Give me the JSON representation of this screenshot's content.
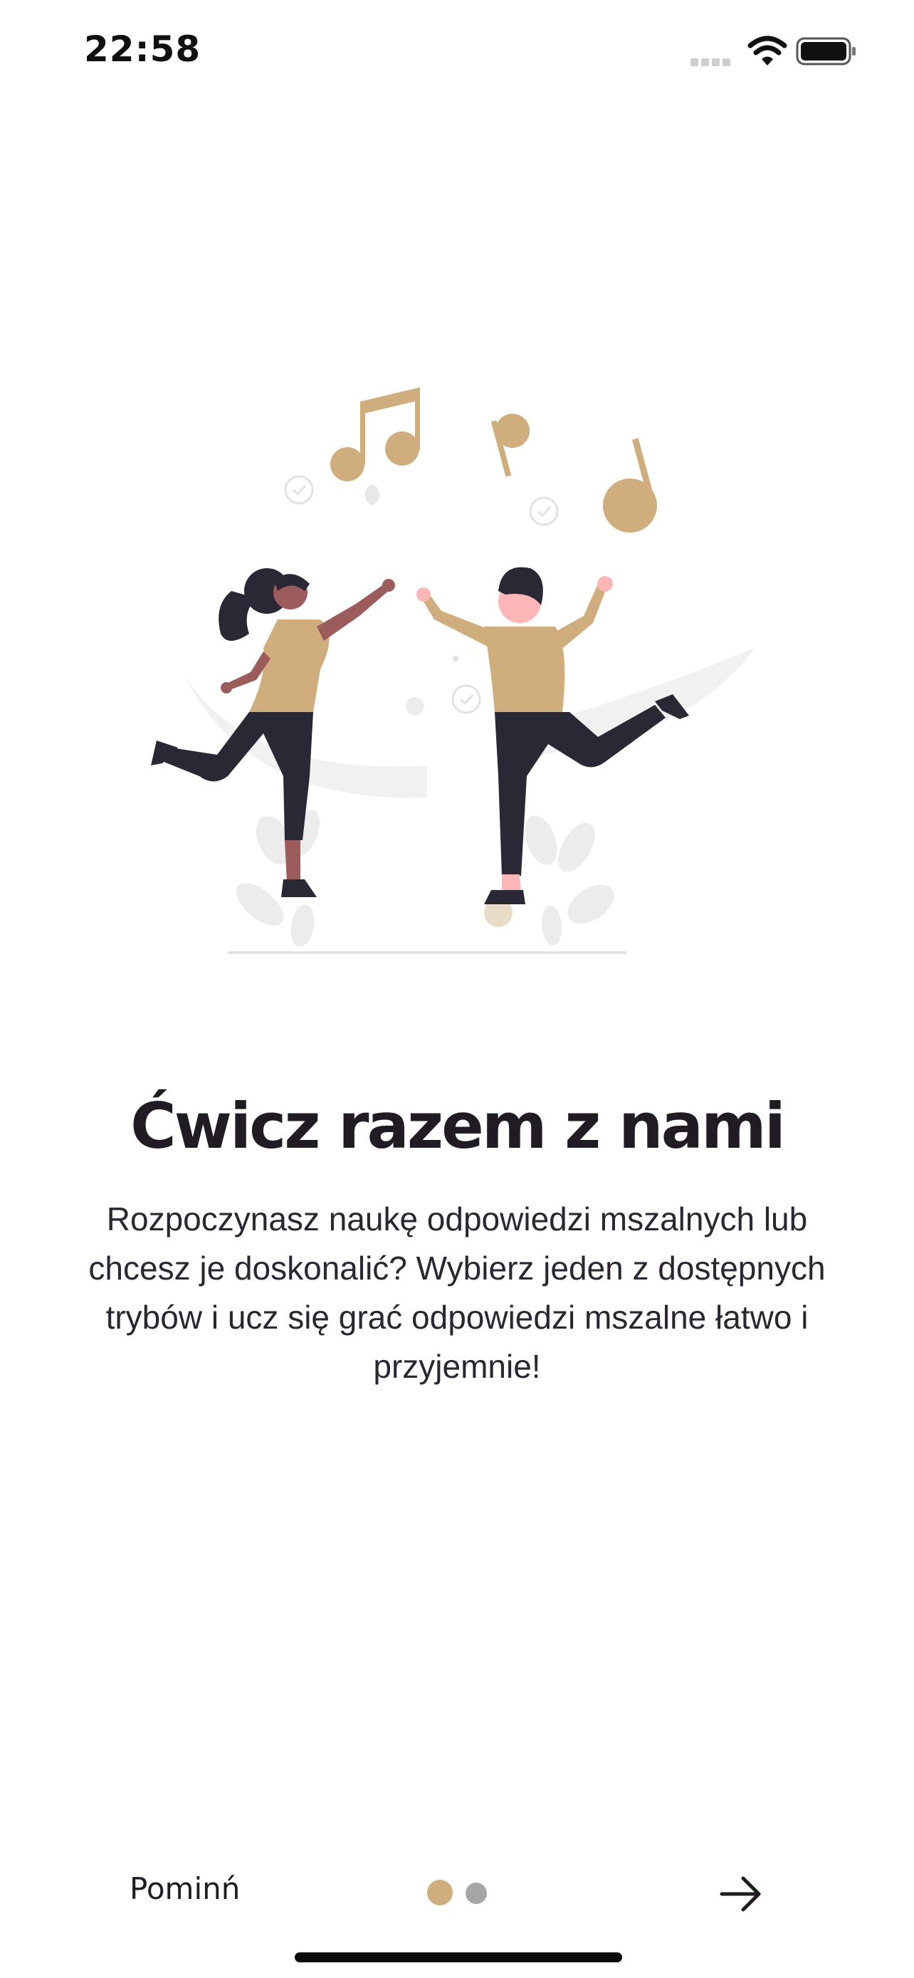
{
  "status_bar": {
    "time": "22:58",
    "icons": [
      "cellular-signal-icon",
      "wifi-icon",
      "battery-icon"
    ]
  },
  "onboarding": {
    "illustration": "dancing-couple-with-music-notes-illustration",
    "title": "Ćwicz razem z nami",
    "description": "Rozpoczynasz naukę odpowiedzi mszalnych lub chcesz je doskonalić? Wybierz jeden z dostępnych trybów i ucz się grać odpowiedzi mszalne łatwo i przyjemnie!"
  },
  "navigation": {
    "skip_label": "Pominń",
    "page_count": 2,
    "current_page": 1,
    "next_icon": "arrow-right-icon"
  },
  "colors": {
    "accent": "#d0ad7d",
    "dot_inactive": "#a6a6a6",
    "text_primary": "#211c24",
    "background": "#ffffff"
  }
}
